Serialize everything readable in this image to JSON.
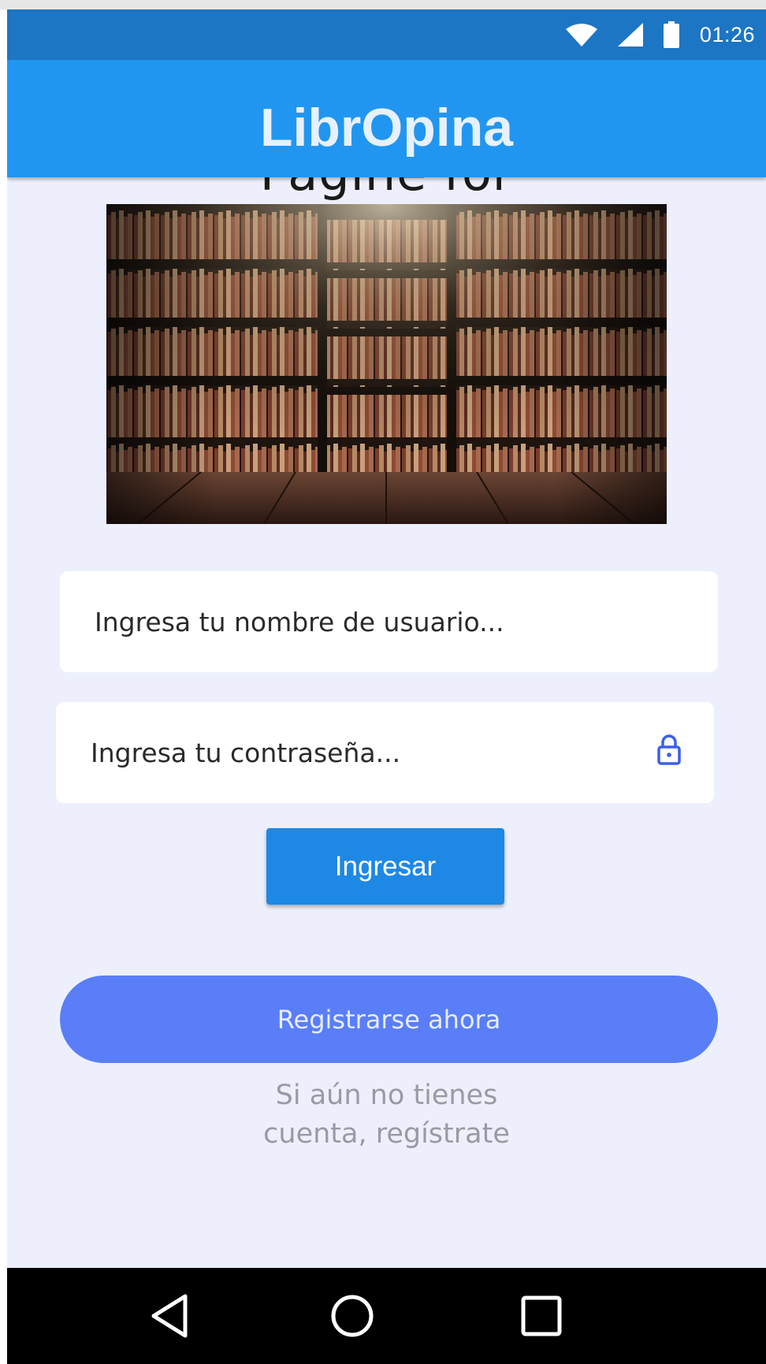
{
  "status_bar": {
    "time": "01:26",
    "icons": [
      "wifi-icon",
      "signal-icon",
      "battery-icon"
    ],
    "color": "#1c76c4"
  },
  "app_bar": {
    "title": "LibrOpina",
    "color": "#2196f0"
  },
  "page_heading": "Págine for",
  "hero_image": {
    "description": "library-bookshelves-image"
  },
  "login_form": {
    "username_placeholder": "Ingresa tu nombre de usuario...",
    "password_placeholder": "Ingresa tu contraseña...",
    "password_icon": "lock-icon",
    "login_label": "Ingresar"
  },
  "register": {
    "button_label": "Registrarse ahora",
    "hint_line1": "Si aún no tienes",
    "hint_line2": "cuenta, regístrate"
  },
  "nav_bar": {
    "buttons": [
      "back-icon",
      "home-icon",
      "recents-icon"
    ]
  },
  "colors": {
    "background": "#edf0fc",
    "login_button": "#1e88e5",
    "register_button": "#597ef7"
  }
}
